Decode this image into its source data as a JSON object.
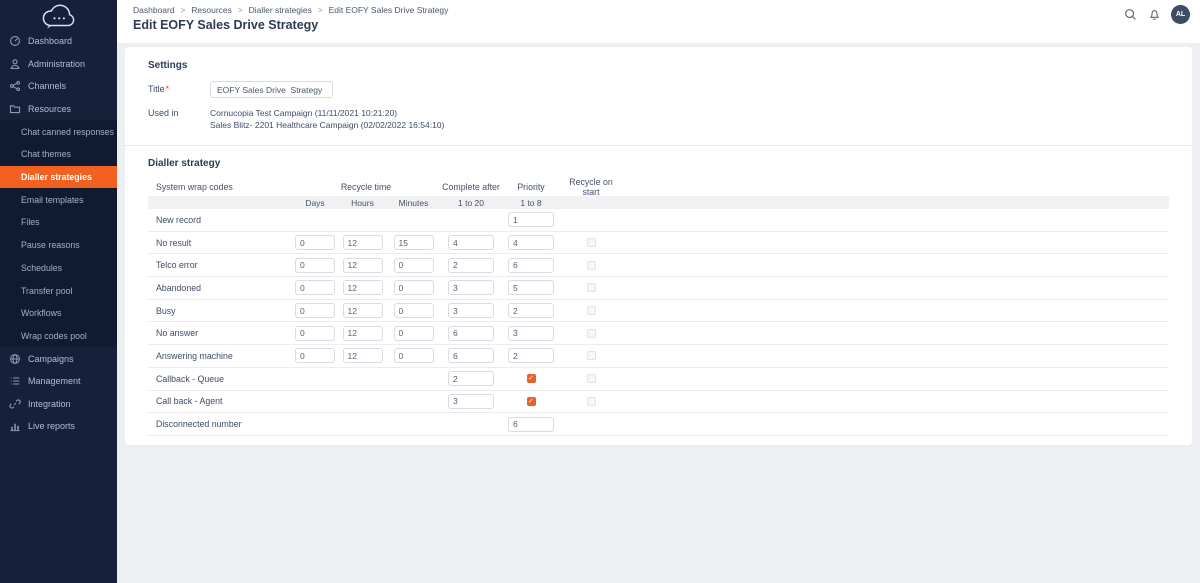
{
  "colors": {
    "accent_orange": "#f2611f",
    "checkbox_checked": "#e8612d",
    "sidebar_bg": "#16203a"
  },
  "sidebar": {
    "items_top": [
      {
        "label": "Dashboard",
        "icon": "dashboard-icon"
      },
      {
        "label": "Administration",
        "icon": "administration-icon"
      },
      {
        "label": "Channels",
        "icon": "channels-icon"
      },
      {
        "label": "Resources",
        "icon": "resources-icon"
      }
    ],
    "submenu": [
      {
        "label": "Chat canned responses",
        "active": false
      },
      {
        "label": "Chat themes",
        "active": false
      },
      {
        "label": "Dialler strategies",
        "active": true
      },
      {
        "label": "Email templates",
        "active": false
      },
      {
        "label": "Files",
        "active": false
      },
      {
        "label": "Pause reasons",
        "active": false
      },
      {
        "label": "Schedules",
        "active": false
      },
      {
        "label": "Transfer pool",
        "active": false
      },
      {
        "label": "Workflows",
        "active": false
      },
      {
        "label": "Wrap codes pool",
        "active": false
      }
    ],
    "items_bottom": [
      {
        "label": "Campaigns",
        "icon": "campaigns-icon"
      },
      {
        "label": "Management",
        "icon": "management-icon"
      },
      {
        "label": "Integration",
        "icon": "integration-icon"
      },
      {
        "label": "Live reports",
        "icon": "live-reports-icon"
      }
    ]
  },
  "header": {
    "breadcrumb": [
      "Dashboard",
      "Resources",
      "Dialler strategies",
      "Edit EOFY Sales Drive Strategy"
    ],
    "title": "Edit EOFY Sales Drive Strategy",
    "avatar": "AL"
  },
  "settings": {
    "heading": "Settings",
    "title_label": "Title",
    "required_mark": "*",
    "title_value": "EOFY Sales Drive  Strategy",
    "used_in_label": "Used in",
    "used_in": [
      "Cornucopia Test Campaign (11/11/2021 10:21:20)",
      "Sales Blitz- 2201 Healthcare Campaign (02/02/2022 16:54:10)"
    ]
  },
  "dialler_table": {
    "heading": "Dialler strategy",
    "columns": {
      "system_wrap_codes": "System wrap codes",
      "recycle_time": "Recycle time",
      "complete_after": "Complete after",
      "priority": "Priority",
      "recycle_on_start": "Recycle on start"
    },
    "subcolumns": {
      "days": "Days",
      "hours": "Hours",
      "minutes": "Minutes",
      "complete_range": "1 to 20",
      "priority_range": "1 to 8"
    },
    "rows": [
      {
        "label": "New record",
        "days": null,
        "hours": null,
        "minutes": null,
        "complete_after": null,
        "priority": "1",
        "recycle_on_start": null
      },
      {
        "label": "No result",
        "days": "0",
        "hours": "12",
        "minutes": "15",
        "complete_after": "4",
        "priority": "4",
        "recycle_on_start": "unchecked"
      },
      {
        "label": "Telco error",
        "days": "0",
        "hours": "12",
        "minutes": "0",
        "complete_after": "2",
        "priority": "6",
        "recycle_on_start": "unchecked"
      },
      {
        "label": "Abandoned",
        "days": "0",
        "hours": "12",
        "minutes": "0",
        "complete_after": "3",
        "priority": "5",
        "recycle_on_start": "unchecked"
      },
      {
        "label": "Busy",
        "days": "0",
        "hours": "12",
        "minutes": "0",
        "complete_after": "3",
        "priority": "2",
        "recycle_on_start": "unchecked"
      },
      {
        "label": "No answer",
        "days": "0",
        "hours": "12",
        "minutes": "0",
        "complete_after": "6",
        "priority": "3",
        "recycle_on_start": "unchecked"
      },
      {
        "label": "Answering machine",
        "days": "0",
        "hours": "12",
        "minutes": "0",
        "complete_after": "6",
        "priority": "2",
        "recycle_on_start": "unchecked"
      },
      {
        "label": "Callback - Queue",
        "days": null,
        "hours": null,
        "minutes": null,
        "complete_after": "2",
        "priority": "checked",
        "recycle_on_start": "unchecked"
      },
      {
        "label": "Call back - Agent",
        "days": null,
        "hours": null,
        "minutes": null,
        "complete_after": "3",
        "priority": "checked",
        "recycle_on_start": "unchecked"
      },
      {
        "label": "Disconnected number",
        "days": null,
        "hours": null,
        "minutes": null,
        "complete_after": null,
        "priority": "6",
        "recycle_on_start": null
      }
    ]
  }
}
